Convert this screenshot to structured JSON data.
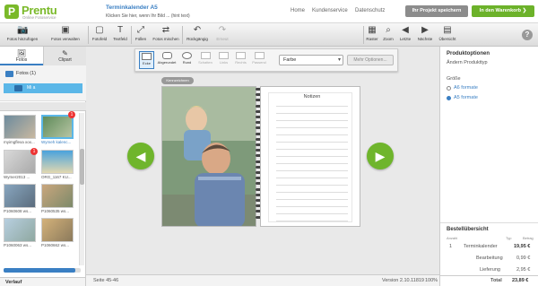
{
  "brand": {
    "name": "Prentu",
    "tagline": "Online Fotoservice",
    "mark": "P"
  },
  "header": {
    "title": "Terminkalender A5",
    "hint": "Klicken Sie hier, wenn Ihr Bild ... (hint text)",
    "links": [
      "Home",
      "Kundenservice",
      "Datenschutz"
    ],
    "save_label": "Ihr Projekt speichern",
    "cart_label": "In den Warenkorb",
    "cart_arrow": "❯"
  },
  "colors": {
    "accent": "#7ab929",
    "link": "#3a7fc3",
    "save_bg": "#8c8c8c",
    "cart_bg": "#6cb22a",
    "badge": "#e33333"
  },
  "toolbar": {
    "left": [
      {
        "label": "Fotos hinzufügen",
        "icon": "camera-icon"
      },
      {
        "label": "Fotos verwalten",
        "icon": "photos-icon"
      }
    ],
    "main": [
      {
        "label": "Fotofeld",
        "icon": "photo-field-icon",
        "disabled": false
      },
      {
        "label": "Textfeld",
        "icon": "text-field-icon",
        "disabled": false
      },
      {
        "label": "Füllen",
        "icon": "fill-icon",
        "disabled": false
      },
      {
        "label": "Fotos mischen",
        "icon": "shuffle-icon",
        "disabled": false
      },
      {
        "label": "Rückgängig",
        "icon": "undo-icon",
        "disabled": false
      },
      {
        "label": "Erneut",
        "icon": "redo-icon",
        "disabled": true
      }
    ],
    "view": [
      {
        "label": "Raster",
        "icon": "grid-icon"
      },
      {
        "label": "Zoom",
        "icon": "zoom-icon"
      },
      {
        "label": "Letzte",
        "icon": "last-icon"
      },
      {
        "label": "Nächste",
        "icon": "next-icon"
      },
      {
        "label": "Übersicht",
        "icon": "overview-icon"
      }
    ],
    "help": "?"
  },
  "left_panel": {
    "tabs": [
      "Fotos",
      "Clipart"
    ],
    "folder": "Fotos (1)",
    "subfolder": "Mi a",
    "photos": [
      {
        "caption": "myimgflexa xox...",
        "badge": ""
      },
      {
        "caption": "Wymeh kalenc...",
        "badge": "1"
      },
      {
        "caption": "Wymer2013 ...",
        "badge": "1"
      },
      {
        "caption": "ORG_1167 KU...",
        "badge": ""
      },
      {
        "caption": "P1060608 ws...",
        "badge": ""
      },
      {
        "caption": "P1060535 ws...",
        "badge": ""
      },
      {
        "caption": "P1060063 ws...",
        "badge": ""
      },
      {
        "caption": "P1060662 ws...",
        "badge": ""
      }
    ],
    "history": "Verlauf"
  },
  "edit_bar": {
    "buttons": [
      {
        "label": "Ecke",
        "selected": true,
        "disabled": false
      },
      {
        "label": "Abgerundet",
        "selected": false,
        "disabled": false
      },
      {
        "label": "Rund",
        "selected": false,
        "disabled": false
      },
      {
        "label": "Schatten",
        "selected": false,
        "disabled": true
      },
      {
        "label": "Links",
        "selected": false,
        "disabled": true
      },
      {
        "label": "Rechts",
        "selected": false,
        "disabled": true
      },
      {
        "label": "Passend",
        "selected": false,
        "disabled": true
      }
    ],
    "color_select": "Farbe",
    "more_options": "Mehr Optionen..."
  },
  "page": {
    "layout_label": "Kennzeichnen",
    "notes_title": "Notizen"
  },
  "product_options": {
    "title": "Produktoptionen",
    "change_type": "Ändern Produkttyp",
    "size_label": "Größe",
    "sizes": [
      {
        "label": "A6 formate",
        "selected": false
      },
      {
        "label": "A5 formate",
        "selected": true
      }
    ]
  },
  "order": {
    "title": "Bestellübersicht",
    "headers": [
      "Anzahl",
      "",
      "Typ",
      "Betrag"
    ],
    "rows": [
      {
        "qty": "1",
        "name": "Terminkalender",
        "price": "19,95 €"
      },
      {
        "qty": "",
        "name": "Bearbeitung",
        "price": "0,99 €"
      },
      {
        "qty": "",
        "name": "Lieferung",
        "price": "2,95 €"
      }
    ],
    "total_label": "Total",
    "total_value": "23,89 €"
  },
  "status": {
    "pages": "Seite 45-46",
    "version": "Version 2.10.11819",
    "zoom": "100%"
  }
}
